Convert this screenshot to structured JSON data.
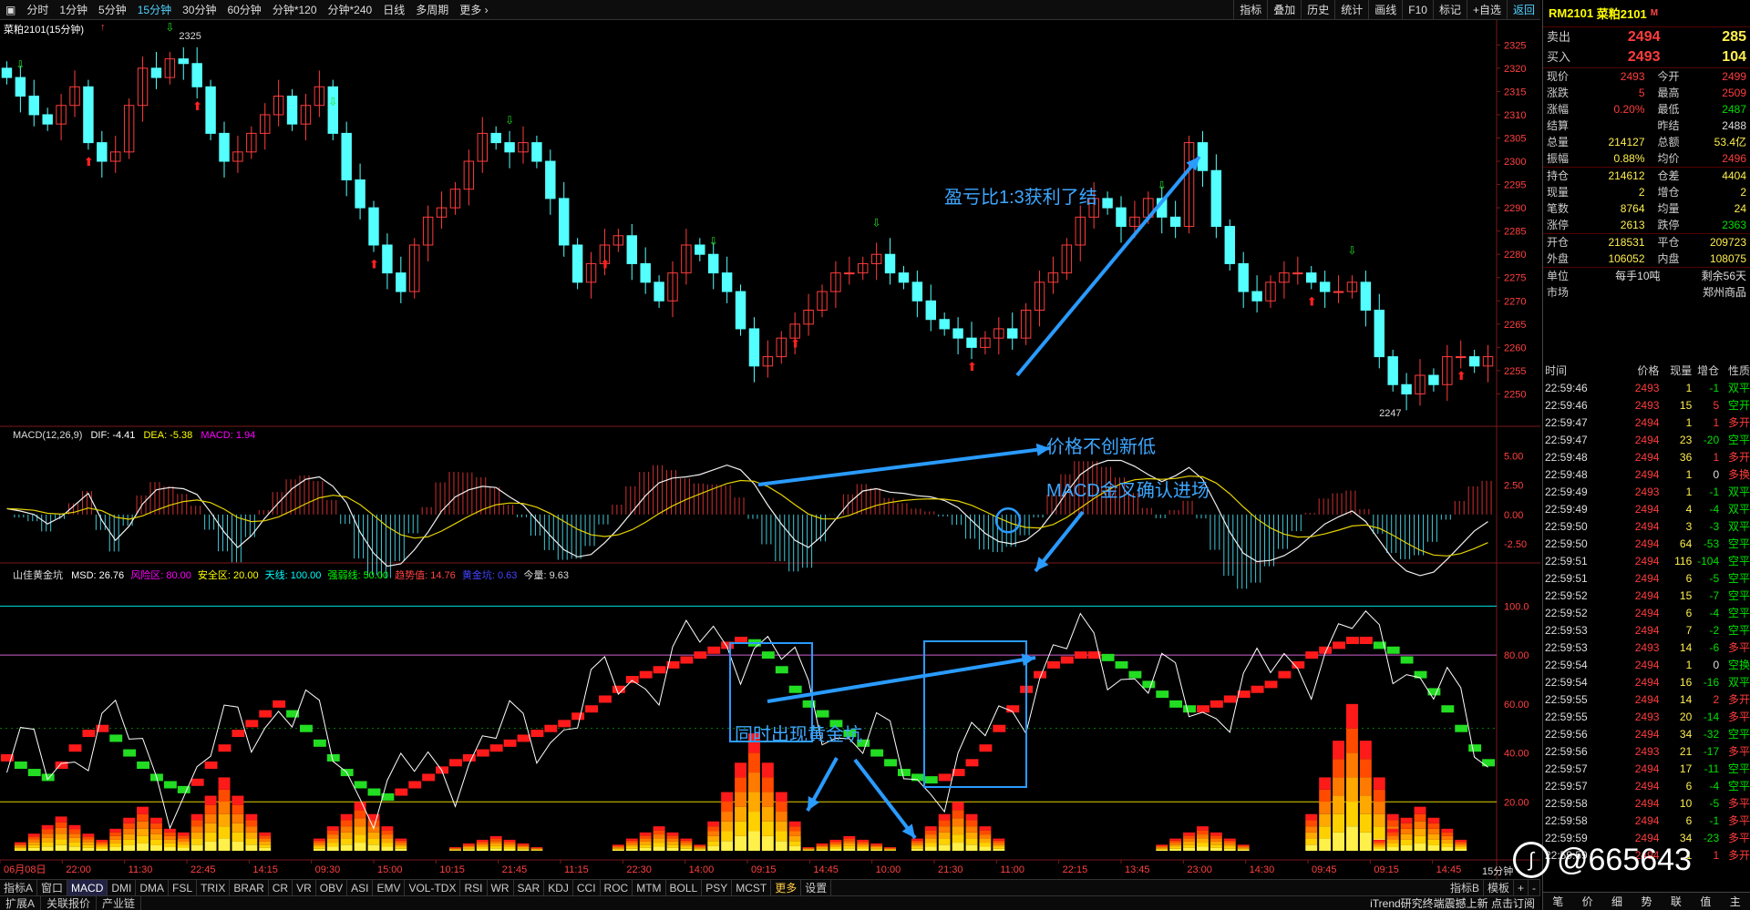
{
  "periods": [
    "分时",
    "1分钟",
    "5分钟",
    "15分钟",
    "30分钟",
    "60分钟",
    "分钟*120",
    "分钟*240",
    "日线",
    "多周期",
    "更多 ›"
  ],
  "active_period": "15分钟",
  "toolbar_right": [
    "指标",
    "叠加",
    "历史",
    "统计",
    "画线",
    "F10",
    "标记",
    "+自选",
    "返回"
  ],
  "chart": {
    "symbol_label": "菜粕2101(15分钟)",
    "price_axis": [
      "2325",
      "2320",
      "2315",
      "2310",
      "2305",
      "2300",
      "2295",
      "2290",
      "2285",
      "2280",
      "2275",
      "2270",
      "2265",
      "2260",
      "2255",
      "2250"
    ],
    "high_label": "2325",
    "low_label": "2247",
    "macd_header": {
      "name": "MACD(12,26,9)",
      "dif": "DIF: -4.41",
      "dea": "DEA: -5.38",
      "macd": "MACD: 1.94"
    },
    "macd_axis": [
      "5.00",
      "2.50",
      "0.00",
      "-2.50"
    ],
    "msd_header": {
      "name": "山佳黄金坑",
      "msd": "MSD: 26.76",
      "risk": "风险区: 80.00",
      "safe": "安全区: 20.00",
      "sky": "天线: 100.00",
      "strong": "强弱线: 50.00",
      "trend": "趋势值: 14.76",
      "gold": "黄金坑: 0.63",
      "vol": "今量: 9.63"
    },
    "msd_axis": [
      "100.0",
      "80.00",
      "60.00",
      "40.00",
      "20.00"
    ],
    "time_axis": [
      "06月08日",
      "22:00",
      "11:30",
      "22:45",
      "14:15",
      "09:30",
      "15:00",
      "10:15",
      "21:45",
      "11:15",
      "22:30",
      "14:00",
      "09:15",
      "14:45",
      "10:00",
      "21:30",
      "11:00",
      "22:15",
      "13:45",
      "23:00",
      "14:30",
      "09:45",
      "09:15",
      "14:45"
    ],
    "period_label": "15分钟",
    "annotations": {
      "profit": "盈亏比1:3获利了结",
      "no_new_low": "价格不创新低",
      "macd_cross": "MACD金叉确认进场",
      "gold_pit": "同时出现黄金坑"
    }
  },
  "chart_data": {
    "type": "candlestick",
    "ylim": [
      2245,
      2328
    ],
    "close": [
      2318,
      2314,
      2310,
      2308,
      2312,
      2316,
      2304,
      2300,
      2302,
      2312,
      2320,
      2318,
      2322,
      2321,
      2316,
      2306,
      2300,
      2302,
      2306,
      2310,
      2314,
      2308,
      2312,
      2316,
      2306,
      2296,
      2290,
      2282,
      2276,
      2272,
      2282,
      2288,
      2290,
      2294,
      2300,
      2306,
      2304,
      2302,
      2304,
      2300,
      2292,
      2282,
      2274,
      2278,
      2282,
      2284,
      2278,
      2274,
      2270,
      2276,
      2282,
      2280,
      2276,
      2272,
      2264,
      2256,
      2258,
      2262,
      2265,
      2268,
      2272,
      2276,
      2276,
      2278,
      2280,
      2276,
      2274,
      2270,
      2266,
      2264,
      2262,
      2260,
      2262,
      2264,
      2262,
      2268,
      2274,
      2276,
      2282,
      2288,
      2292,
      2290,
      2286,
      2288,
      2292,
      2288,
      2286,
      2304,
      2298,
      2286,
      2278,
      2272,
      2270,
      2274,
      2276,
      2276,
      2274,
      2272,
      2272,
      2274,
      2268,
      2258,
      2252,
      2250,
      2254,
      2252,
      2258,
      2258,
      2256,
      2258
    ],
    "macd_dif": [
      0.5,
      0.3,
      0,
      -0.8,
      -0.2,
      0.8,
      1.8,
      -0.5,
      -2.2,
      -1,
      0.9,
      2.1,
      2.3,
      2.2,
      1.7,
      0.2,
      -1.5,
      -2.8,
      -1.8,
      -0.3,
      1,
      2.2,
      3,
      3.2,
      2.4,
      1,
      -1.5,
      -3.3,
      -4.4,
      -4.2,
      -3,
      -1.5,
      0.3,
      1.5,
      2.1,
      2.4,
      2.3,
      1.5,
      0.8,
      -0.5,
      -1.8,
      -3,
      -3.6,
      -3.4,
      -2.4,
      -1.2,
      0.2,
      1.6,
      2.7,
      3.1,
      3.2,
      3.4,
      3.8,
      4.2,
      3.8,
      2.6,
      0.8,
      -0.8,
      -2.2,
      -2.8,
      -1.8,
      -0.4,
      1,
      2,
      2.2,
      1.9,
      1.8,
      1.6,
      1.5,
      1.2,
      0.6,
      -0.5,
      -1.6,
      -2.3,
      -2.5,
      -2.2,
      -1.3,
      0.2,
      1.9,
      3.4,
      4.2,
      4.6,
      4.6,
      4.1,
      3.4,
      2.8,
      3.3,
      4,
      3,
      0.8,
      -1.5,
      -3.3,
      -4,
      -3.9,
      -3.5,
      -2.8,
      -1.8,
      -0.8,
      -0.2,
      0.3,
      -0.6,
      -2.2,
      -3.8,
      -4.8,
      -5.2,
      -4.9,
      -3.8,
      -2.6,
      -1.4,
      -0.6
    ],
    "msd_trend": [
      38,
      35,
      32,
      30,
      35,
      42,
      48,
      50,
      46,
      40,
      35,
      30,
      27,
      25,
      28,
      35,
      42,
      48,
      52,
      56,
      60,
      56,
      50,
      44,
      38,
      32,
      27,
      24,
      22,
      24,
      27,
      30,
      33,
      36,
      38,
      40,
      42,
      44,
      46,
      48,
      50,
      52,
      55,
      58,
      62,
      66,
      70,
      72,
      74,
      76,
      78,
      80,
      82,
      84,
      86,
      85,
      80,
      74,
      66,
      60,
      56,
      52,
      48,
      44,
      40,
      36,
      32,
      30,
      29,
      30,
      32,
      36,
      42,
      50,
      58,
      66,
      72,
      76,
      78,
      80,
      80,
      79,
      76,
      72,
      68,
      64,
      60,
      58,
      58,
      60,
      62,
      64,
      66,
      68,
      72,
      76,
      80,
      82,
      84,
      86,
      86,
      84,
      82,
      78,
      72,
      65,
      58,
      50,
      42,
      36
    ]
  },
  "quote": {
    "code": "RM2101",
    "name": "菜粕2101",
    "market_flag": "M",
    "sell_label": "卖出",
    "sell_price": "2494",
    "sell_vol": "285",
    "buy_label": "买入",
    "buy_price": "2493",
    "buy_vol": "104",
    "rows": [
      [
        "现价",
        "2493",
        "今开",
        "2499"
      ],
      [
        "涨跌",
        "5",
        "最高",
        "2509"
      ],
      [
        "涨幅",
        "0.20%",
        "最低",
        "2487"
      ],
      [
        "结算",
        "",
        "昨结",
        "2488"
      ],
      [
        "总量",
        "214127",
        "总额",
        "53.4亿"
      ],
      [
        "振幅",
        "0.88%",
        "均价",
        "2496"
      ]
    ],
    "rows2": [
      [
        "持仓",
        "214612",
        "仓差",
        "4404"
      ],
      [
        "现量",
        "2",
        "增仓",
        "2"
      ],
      [
        "笔数",
        "8764",
        "均量",
        "24"
      ],
      [
        "涨停",
        "2613",
        "跌停",
        "2363"
      ]
    ],
    "rows3": [
      [
        "开仓",
        "218531",
        "平仓",
        "209723"
      ],
      [
        "外盘",
        "106052",
        "内盘",
        "108075"
      ]
    ],
    "unit_label": "单位",
    "unit_value": "每手10吨",
    "remain": "剩余56天",
    "market_label": "市场",
    "market_value": "郑州商品"
  },
  "ticks_header": [
    "时间",
    "价格",
    "现量",
    "增仓",
    "性质"
  ],
  "ticks": [
    [
      "22:59:46",
      "2493",
      "1",
      "-1",
      "双平"
    ],
    [
      "22:59:46",
      "2493",
      "15",
      "5",
      "空开"
    ],
    [
      "22:59:47",
      "2494",
      "1",
      "1",
      "多开"
    ],
    [
      "22:59:47",
      "2494",
      "23",
      "-20",
      "空平"
    ],
    [
      "22:59:48",
      "2494",
      "36",
      "1",
      "多开"
    ],
    [
      "22:59:48",
      "2494",
      "1",
      "0",
      "多换"
    ],
    [
      "22:59:49",
      "2493",
      "1",
      "-1",
      "双平"
    ],
    [
      "22:59:49",
      "2494",
      "4",
      "-4",
      "双平"
    ],
    [
      "22:59:50",
      "2494",
      "3",
      "-3",
      "双平"
    ],
    [
      "22:59:50",
      "2494",
      "64",
      "-53",
      "空平"
    ],
    [
      "22:59:51",
      "2494",
      "116",
      "-104",
      "空平"
    ],
    [
      "22:59:51",
      "2494",
      "6",
      "-5",
      "空平"
    ],
    [
      "22:59:52",
      "2494",
      "15",
      "-7",
      "空平"
    ],
    [
      "22:59:52",
      "2494",
      "6",
      "-4",
      "空平"
    ],
    [
      "22:59:53",
      "2494",
      "7",
      "-2",
      "空平"
    ],
    [
      "22:59:53",
      "2493",
      "14",
      "-6",
      "多平"
    ],
    [
      "22:59:54",
      "2494",
      "1",
      "0",
      "空换"
    ],
    [
      "22:59:54",
      "2494",
      "16",
      "-16",
      "双平"
    ],
    [
      "22:59:55",
      "2494",
      "14",
      "2",
      "多开"
    ],
    [
      "22:59:55",
      "2493",
      "20",
      "-14",
      "多平"
    ],
    [
      "22:59:56",
      "2494",
      "34",
      "-32",
      "空平"
    ],
    [
      "22:59:56",
      "2493",
      "21",
      "-17",
      "多平"
    ],
    [
      "22:59:57",
      "2494",
      "17",
      "-11",
      "空平"
    ],
    [
      "22:59:57",
      "2494",
      "6",
      "-4",
      "空平"
    ],
    [
      "22:59:58",
      "2494",
      "10",
      "-5",
      "多平"
    ],
    [
      "22:59:58",
      "2494",
      "6",
      "-1",
      "多平"
    ],
    [
      "22:59:59",
      "2494",
      "34",
      "-23",
      "多平"
    ],
    [
      "22:59:59",
      "2494",
      "1",
      "1",
      "多开"
    ]
  ],
  "right_tabs": [
    "笔",
    "价",
    "细",
    "势",
    "联",
    "值",
    "主"
  ],
  "taskbar": [
    "指标A",
    "窗口",
    "MACD",
    "DMI",
    "DMA",
    "FSL",
    "TRIX",
    "BRAR",
    "CR",
    "VR",
    "OBV",
    "ASI",
    "EMV",
    "VOL-TDX",
    "RSI",
    "WR",
    "SAR",
    "KDJ",
    "CCI",
    "ROC",
    "MTM",
    "BOLL",
    "PSY",
    "MCST",
    "更多",
    "设置"
  ],
  "taskbar_right": [
    "指标B",
    "模板",
    "+",
    "-"
  ],
  "bottom_tabs": [
    "扩展A",
    "关联报价",
    "产业链"
  ],
  "status_text": "iTrend研究终端震撼上新 点击订阅",
  "watermark": "@665643",
  "colors": {
    "up": "#ff3c3c",
    "down": "#54ffff",
    "accent": "#4fd2ff",
    "annotation": "#3da7ff",
    "gold": "#ffd700",
    "trend_up": "#ff1a1a",
    "trend_down": "#22dd22"
  }
}
